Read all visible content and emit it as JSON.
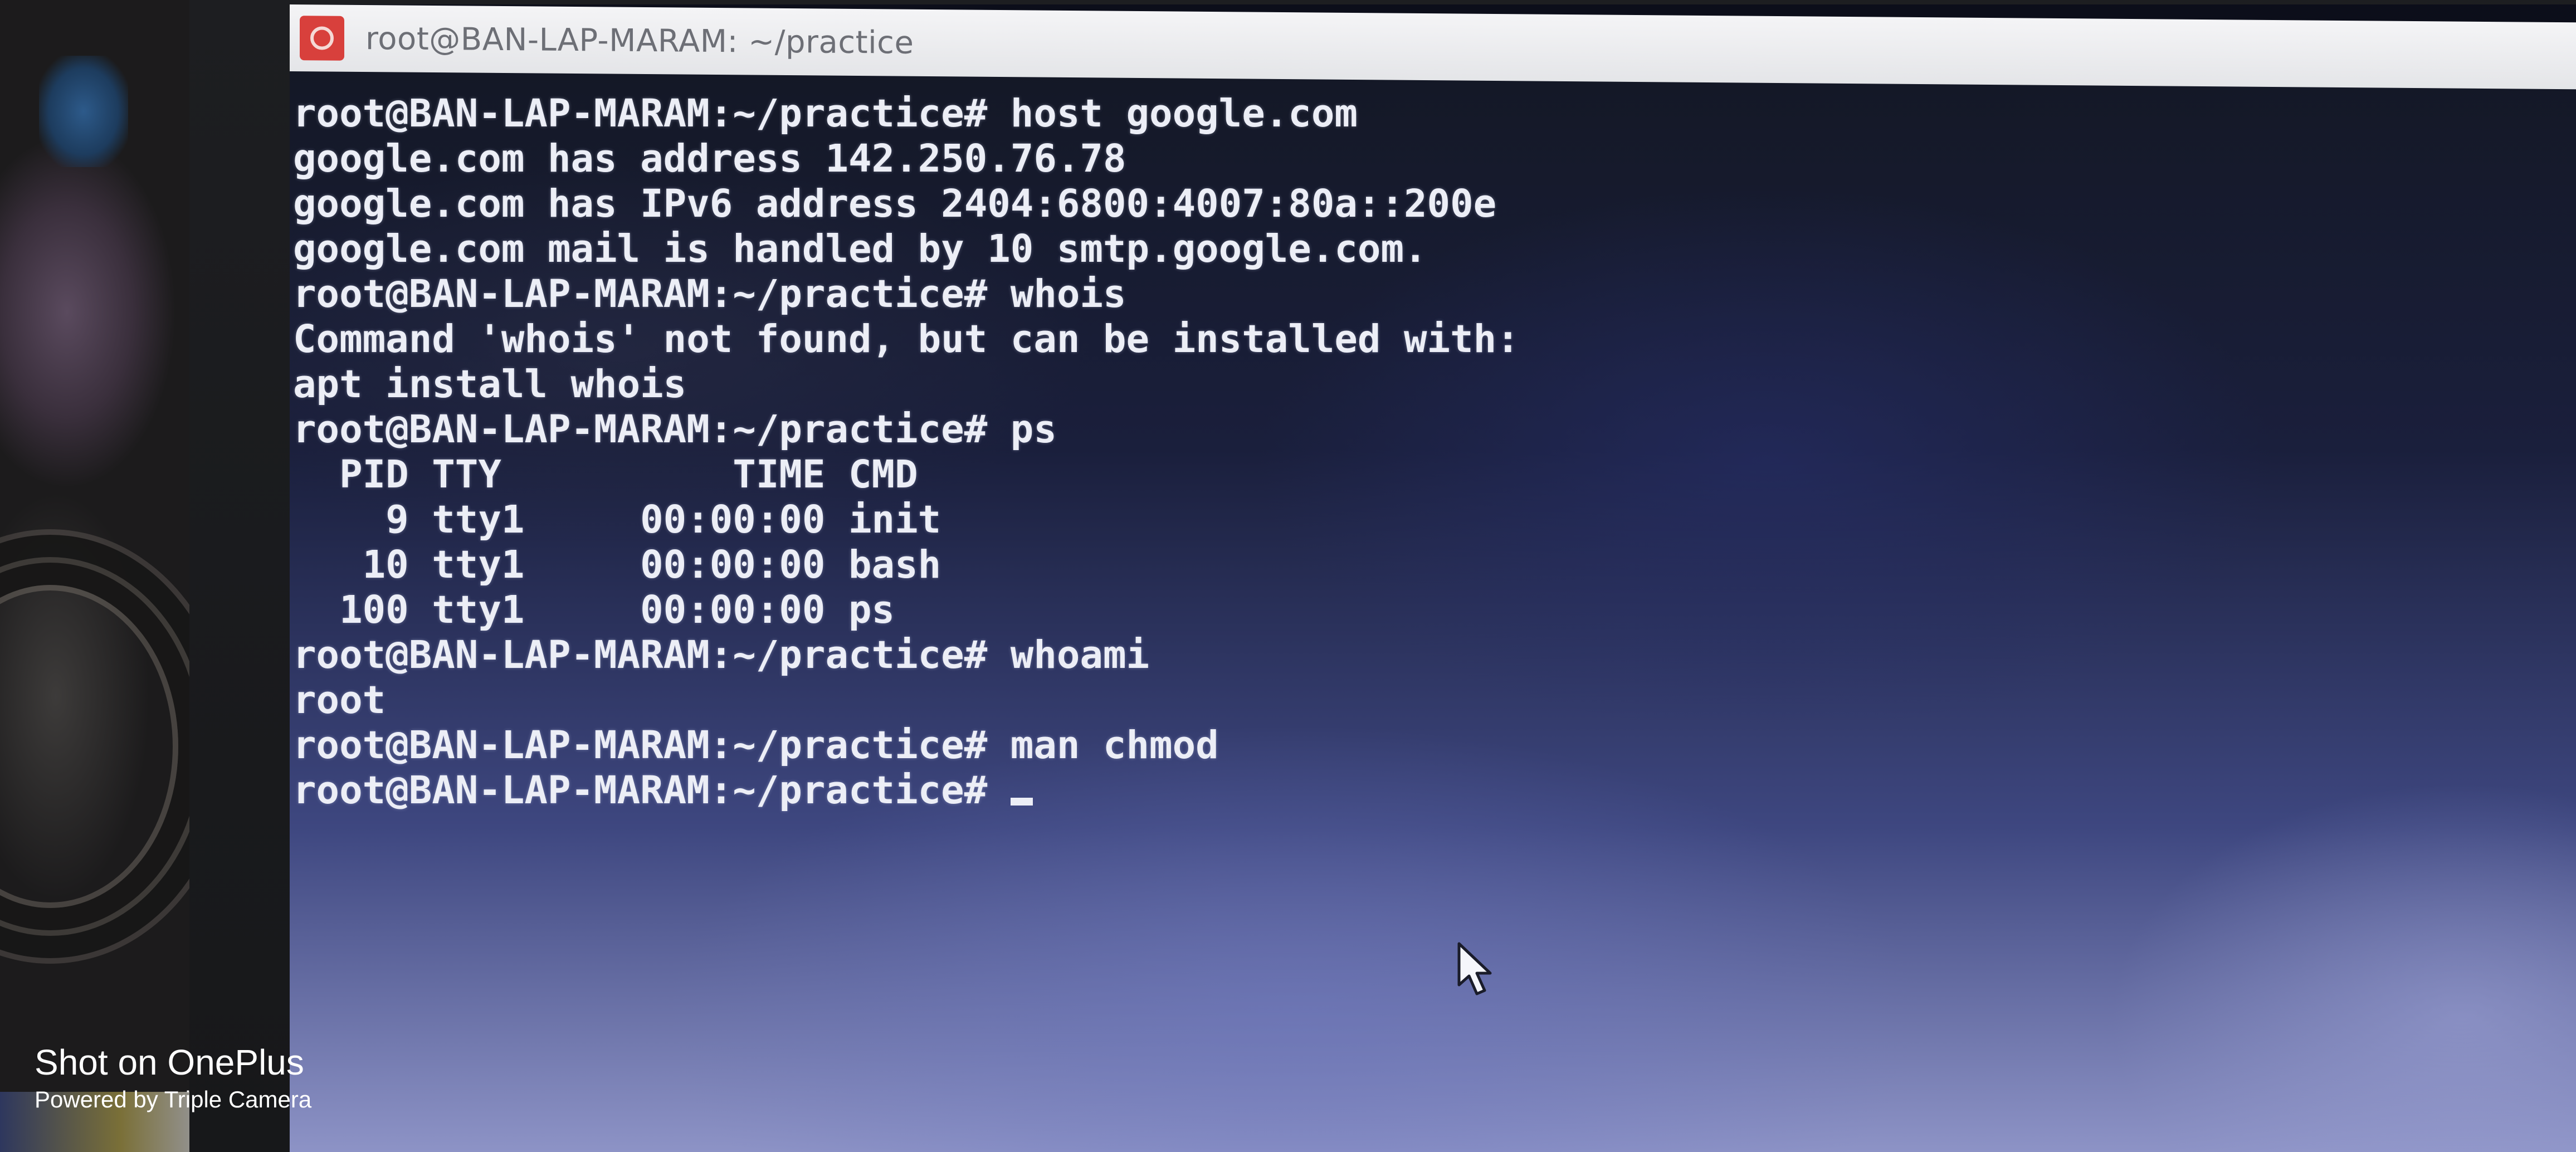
{
  "window": {
    "title": "root@BAN-LAP-MARAM: ~/practice",
    "app_icon": "terminal-app-icon"
  },
  "terminal": {
    "lines": [
      "root@BAN-LAP-MARAM:~/practice# host google.com",
      "google.com has address 142.250.76.78",
      "google.com has IPv6 address 2404:6800:4007:80a::200e",
      "google.com mail is handled by 10 smtp.google.com.",
      "root@BAN-LAP-MARAM:~/practice# whois",
      "Command 'whois' not found, but can be installed with:",
      "apt install whois",
      "root@BAN-LAP-MARAM:~/practice# ps",
      "  PID TTY          TIME CMD",
      "    9 tty1     00:00:00 init",
      "   10 tty1     00:00:00 bash",
      "  100 tty1     00:00:00 ps",
      "root@BAN-LAP-MARAM:~/practice# whoami",
      "root",
      "root@BAN-LAP-MARAM:~/practice# man chmod"
    ],
    "prompt": "root@BAN-LAP-MARAM:~/practice# ",
    "cursor_icon": "block-cursor",
    "text_color": "#eceef6",
    "background_color": "#1a1f3c"
  },
  "pointer": {
    "icon": "mouse-pointer-icon"
  },
  "watermark": {
    "line1": "Shot on OnePlus",
    "line2": "Powered by Triple Camera"
  },
  "colors": {
    "title_bar": "#f4f4f6",
    "title_text": "#6d6f76",
    "app_icon": "#d8403c"
  }
}
